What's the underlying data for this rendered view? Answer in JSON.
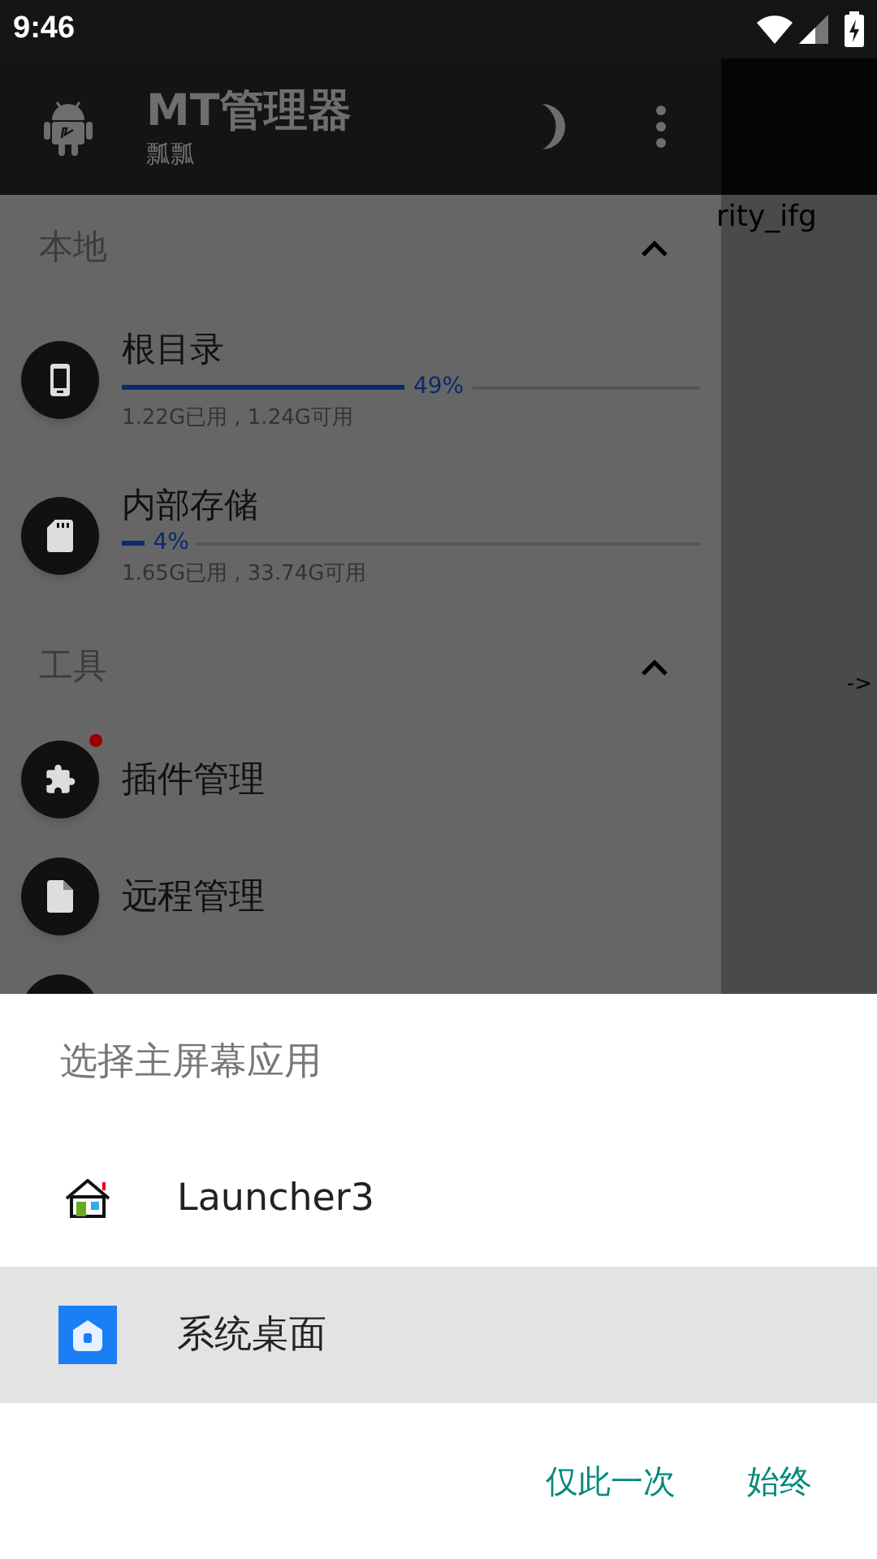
{
  "status_bar": {
    "time": "9:46"
  },
  "app_bar": {
    "title": "MT管理器",
    "subtitle": "瓢瓢"
  },
  "background_fragments": [
    "rity_ifg",
    "->"
  ],
  "drawer": {
    "sections": [
      {
        "title": "本地",
        "expanded": true,
        "items": [
          {
            "kind": "storage",
            "label": "根目录",
            "level": 0.49,
            "percent": "49%",
            "usage": "1.22G已用 , 1.24G可用"
          },
          {
            "kind": "storage",
            "label": "内部存储",
            "level": 0.04,
            "percent": "4%",
            "usage": "1.65G已用 , 33.74G可用"
          }
        ]
      },
      {
        "title": "工具",
        "expanded": true,
        "items": [
          {
            "kind": "tool",
            "label": "插件管理",
            "badge": true
          },
          {
            "kind": "tool",
            "label": "远程管理",
            "badge": false
          },
          {
            "kind": "tool"
          }
        ]
      }
    ]
  },
  "dialog": {
    "title": "选择主屏幕应用",
    "apps": [
      {
        "label": "Launcher3",
        "selected": false
      },
      {
        "label": "系统桌面",
        "selected": true
      }
    ],
    "buttons": [
      "仅此一次",
      "始终"
    ]
  }
}
